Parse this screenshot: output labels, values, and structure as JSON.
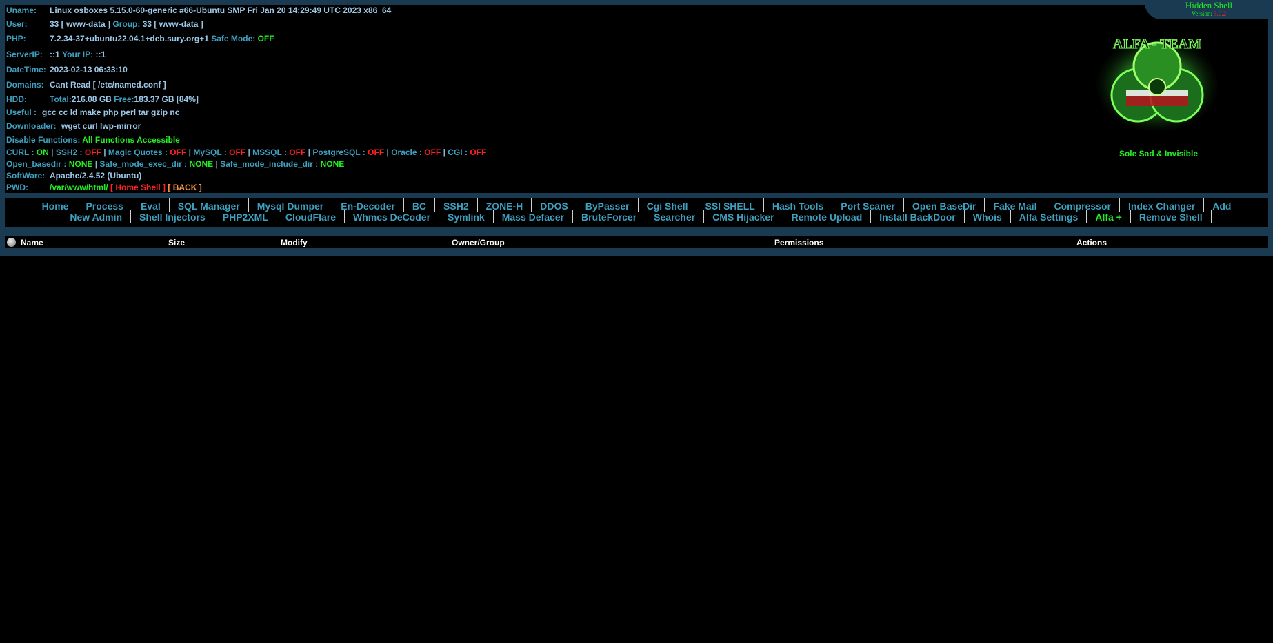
{
  "sysinfo": {
    "uname_label": "Uname:",
    "uname_value": "Linux osboxes 5.15.0-60-generic #66-Ubuntu SMP Fri Jan 20 14:29:49 UTC 2023 x86_64",
    "user_label": "User:",
    "user_value": "33 [ www-data ]",
    "group_label": "Group:",
    "group_value": "33 [ www-data ]",
    "php_label": "PHP:",
    "php_value": "7.2.34-37+ubuntu22.04.1+deb.sury.org+1",
    "safe_mode_label": "Safe Mode:",
    "safe_mode_value": "OFF",
    "serverip_label": "ServerIP:",
    "serverip_value": "::1",
    "yourip_label": "Your IP:",
    "yourip_value": "::1",
    "datetime_label": "DateTime:",
    "datetime_value": "2023-02-13 06:33:10",
    "domains_label": "Domains:",
    "domains_value": "Cant Read [ /etc/named.conf ]",
    "hdd_label": "HDD:",
    "hdd_total_label": "Total:",
    "hdd_total_value": "216.08 GB",
    "hdd_free_label": "Free:",
    "hdd_free_value": "183.37 GB [84%]",
    "useful_label": "Useful :",
    "useful_value": "gcc cc ld make php perl tar gzip nc",
    "downloader_label": "Downloader:",
    "downloader_value": "wget curl lwp-mirror",
    "disable_label": "Disable Functions:",
    "disable_value": "All Functions Accessible",
    "software_label": "SoftWare:",
    "software_value": "Apache/2.4.52 (Ubuntu)",
    "pwd_label": "PWD:",
    "pwd_value": "/var/www/html/",
    "home_shell": "[ Home Shell ]",
    "back": "[ BACK ]"
  },
  "features": {
    "curl_label": "CURL :",
    "curl_value": "ON",
    "ssh2_label": "SSH2 :",
    "ssh2_value": "OFF",
    "magic_label": "Magic Quotes :",
    "magic_value": "OFF",
    "mysql_label": "MySQL :",
    "mysql_value": "OFF",
    "mssql_label": "MSSQL :",
    "mssql_value": "OFF",
    "pgsql_label": "PostgreSQL :",
    "pgsql_value": "OFF",
    "oracle_label": "Oracle :",
    "oracle_value": "OFF",
    "cgi_label": "CGI :",
    "cgi_value": "OFF",
    "openbase_label": "Open_basedir :",
    "openbase_value": "NONE",
    "exec_label": "Safe_mode_exec_dir :",
    "exec_value": "NONE",
    "include_label": "Safe_mode_include_dir :",
    "include_value": "NONE",
    "separator": "|"
  },
  "brand": {
    "title": "Hidden Shell",
    "version_label": "Version:",
    "version_value": "3.0.2",
    "logo_text": "ALFA - TEAM",
    "caption": "Sole Sad & Invisible"
  },
  "nav": {
    "line1": [
      "Home",
      "Process",
      "Eval",
      "SQL Manager",
      "Mysql Dumper",
      "En-Decoder",
      "BC",
      "SSH2",
      "ZONE-H",
      "DDOS",
      "ByPasser",
      "Cgi Shell",
      "SSI SHELL",
      "Hash Tools",
      "Port Scaner",
      "Open BaseDir",
      "Fake Mail",
      "Compressor",
      "Index Changer",
      "Add"
    ],
    "line2": [
      "New Admin",
      "Shell Injectors",
      "PHP2XML",
      "CloudFlare",
      "Whmcs DeCoder",
      "Symlink",
      "Mass Defacer",
      "BruteForcer",
      "Searcher",
      "CMS Hijacker",
      "Remote Upload",
      "Install BackDoor",
      "Whois",
      "Alfa Settings",
      "Alfa +",
      "Remove Shell"
    ]
  },
  "table": {
    "name": "Name",
    "size": "Size",
    "modify": "Modify",
    "owner": "Owner/Group",
    "permissions": "Permissions",
    "actions": "Actions"
  },
  "colors": {
    "frame": "#1a3a52",
    "label": "#3f9fbf",
    "value": "#9cc8e8",
    "on": "#22ee22",
    "off": "#ff2222"
  }
}
